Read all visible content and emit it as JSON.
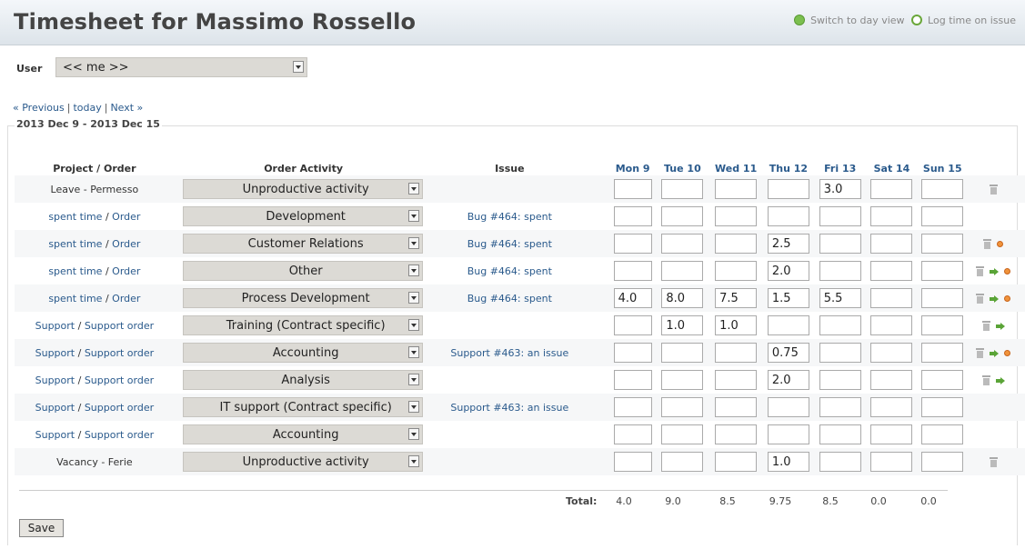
{
  "page": {
    "title": "Timesheet for Massimo Rossello"
  },
  "header_links": {
    "switch_day": "Switch to day view",
    "log_time": "Log time on issue"
  },
  "user": {
    "label": "User",
    "selected": "<< me >>"
  },
  "nav": {
    "previous": "« Previous",
    "today": "today",
    "next": "Next »",
    "sep": "|"
  },
  "period": "2013 Dec 9 - 2013 Dec 15",
  "columns": {
    "project": "Project / Order",
    "activity": "Order Activity",
    "issue": "Issue",
    "days": [
      "Mon 9",
      "Tue 10",
      "Wed 11",
      "Thu 12",
      "Fri 13",
      "Sat 14",
      "Sun 15"
    ]
  },
  "rows": [
    {
      "proj_a": "Leave - Permesso",
      "proj_b": "",
      "link": false,
      "activity": "Unproductive activity",
      "issue": "",
      "vals": [
        "",
        "",
        "",
        "",
        "3.0",
        "",
        ""
      ],
      "icons": [
        "trash"
      ]
    },
    {
      "proj_a": "spent time",
      "proj_b": "Order",
      "link": true,
      "activity": "Development",
      "issue": "Bug #464: spent",
      "vals": [
        "",
        "",
        "",
        "",
        "",
        "",
        ""
      ],
      "icons": []
    },
    {
      "proj_a": "spent time",
      "proj_b": "Order",
      "link": true,
      "activity": "Customer Relations",
      "issue": "Bug #464: spent",
      "vals": [
        "",
        "",
        "",
        "2.5",
        "",
        "",
        ""
      ],
      "icons": [
        "trash",
        "dot"
      ]
    },
    {
      "proj_a": "spent time",
      "proj_b": "Order",
      "link": true,
      "activity": "Other",
      "issue": "Bug #464: spent",
      "vals": [
        "",
        "",
        "",
        "2.0",
        "",
        "",
        ""
      ],
      "icons": [
        "trash",
        "arrow",
        "dot"
      ]
    },
    {
      "proj_a": "spent time",
      "proj_b": "Order",
      "link": true,
      "activity": "Process Development",
      "issue": "Bug #464: spent",
      "vals": [
        "4.0",
        "8.0",
        "7.5",
        "1.5",
        "5.5",
        "",
        ""
      ],
      "icons": [
        "trash",
        "arrow",
        "dot"
      ]
    },
    {
      "proj_a": "Support",
      "proj_b": "Support order",
      "link": true,
      "activity": "Training (Contract specific)",
      "issue": "",
      "vals": [
        "",
        "1.0",
        "1.0",
        "",
        "",
        "",
        ""
      ],
      "icons": [
        "trash",
        "arrow"
      ]
    },
    {
      "proj_a": "Support",
      "proj_b": "Support order",
      "link": true,
      "activity": "Accounting",
      "issue": "Support #463: an issue",
      "vals": [
        "",
        "",
        "",
        "0.75",
        "",
        "",
        ""
      ],
      "icons": [
        "trash",
        "arrow",
        "dot"
      ]
    },
    {
      "proj_a": "Support",
      "proj_b": "Support order",
      "link": true,
      "activity": "Analysis",
      "issue": "",
      "vals": [
        "",
        "",
        "",
        "2.0",
        "",
        "",
        ""
      ],
      "icons": [
        "trash",
        "arrow"
      ]
    },
    {
      "proj_a": "Support",
      "proj_b": "Support order",
      "link": true,
      "activity": "IT support (Contract specific)",
      "issue": "Support #463: an issue",
      "vals": [
        "",
        "",
        "",
        "",
        "",
        "",
        ""
      ],
      "icons": []
    },
    {
      "proj_a": "Support",
      "proj_b": "Support order",
      "link": true,
      "activity": "Accounting",
      "issue": "",
      "vals": [
        "",
        "",
        "",
        "",
        "",
        "",
        ""
      ],
      "icons": []
    },
    {
      "proj_a": "Vacancy - Ferie",
      "proj_b": "",
      "link": false,
      "activity": "Unproductive activity",
      "issue": "",
      "vals": [
        "",
        "",
        "",
        "1.0",
        "",
        "",
        ""
      ],
      "icons": [
        "trash"
      ]
    }
  ],
  "totals": {
    "label": "Total:",
    "values": [
      "4.0",
      "9.0",
      "8.5",
      "9.75",
      "8.5",
      "0.0",
      "0.0"
    ]
  },
  "save_label": "Save"
}
